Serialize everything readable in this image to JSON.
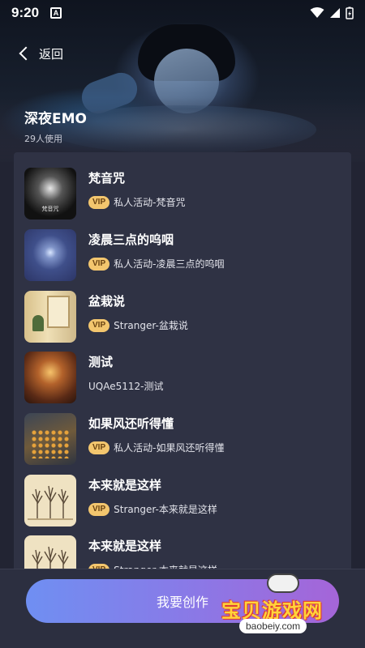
{
  "status_bar": {
    "time": "9:20",
    "notification_icon": "A"
  },
  "nav": {
    "back_label": "返回"
  },
  "header": {
    "title": "深夜EMO",
    "usage": "29人使用"
  },
  "list": {
    "items": [
      {
        "name": "梵音咒",
        "vip": true,
        "vip_label": "VIP",
        "desc": "私人活动-梵音咒",
        "thumb_caption": "梵音咒"
      },
      {
        "name": "凌晨三点的呜咽",
        "vip": true,
        "vip_label": "VIP",
        "desc": "私人活动-凌晨三点的呜咽"
      },
      {
        "name": "盆栽说",
        "vip": true,
        "vip_label": "VIP",
        "desc": "Stranger-盆栽说"
      },
      {
        "name": "测试",
        "vip": false,
        "desc": "UQAe5112-测试"
      },
      {
        "name": "如果风还听得懂",
        "vip": true,
        "vip_label": "VIP",
        "desc": "私人活动-如果风还听得懂"
      },
      {
        "name": "本来就是这样",
        "vip": true,
        "vip_label": "VIP",
        "desc": "Stranger-本来就是这样"
      },
      {
        "name": "本来就是这样",
        "vip": true,
        "vip_label": "VIP",
        "desc": "Stranger-本来就是这样"
      }
    ]
  },
  "bottom": {
    "create_label": "我要创作"
  },
  "watermark": {
    "brand": "宝贝游戏网",
    "url": "baobeiy.com"
  },
  "colors": {
    "background": "#222433",
    "card": "#2f3244",
    "vip_badge": "#f3c66e",
    "button_start": "#6f8ff2",
    "button_end": "#a565d8"
  }
}
